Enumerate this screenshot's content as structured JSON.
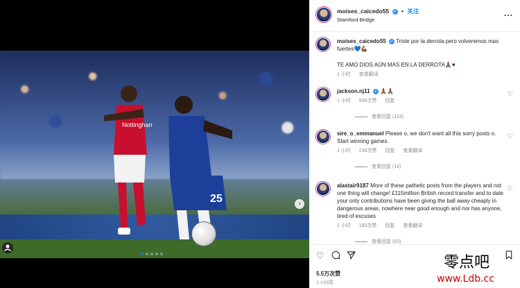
{
  "header": {
    "username": "moises_caicedo55",
    "follow_label": "关注",
    "location": "Stamford Bridge",
    "more": "..."
  },
  "caption": {
    "username": "moises_caicedo55",
    "text": "Triste por la derrota pero volveremos mas fuertes💙💪🏾",
    "text2": "TE AMO DIOS AÚN MAS EN LA DERROTA🙏🏾♥",
    "time": "1 小时",
    "see_translation": "查看翻译"
  },
  "comments": [
    {
      "username": "jackson.nj11",
      "text": "🙏🏾🙏🏾",
      "time": "1 小时",
      "likes": "588次赞",
      "reply": "回复",
      "view_replies": "查看回复 (124)"
    },
    {
      "username": "sire_o_emmanuel",
      "text": "Please o, we don't want all this sorry posts o. Start winning games.",
      "time": "1 小时",
      "likes": "238次赞",
      "reply": "回复",
      "translate": "查看翻译",
      "view_replies": "查看回复 (14)"
    },
    {
      "username": "alastair9187",
      "text": "More of these pathetic posts from the players and not one thing will change! £115million British record transfer and to date your only contributions have been giving the ball away cheaply in dangerous areas, nowhere near good enough and nor has anyone, tired of excuses",
      "time": "1 小时",
      "likes": "180次赞",
      "reply": "回复",
      "translate": "查看翻译",
      "view_replies": "查看回复 (63)"
    }
  ],
  "footer": {
    "likes": "5.5万次赞",
    "date": "1 小时前"
  },
  "photo": {
    "jersey_number": "25",
    "sponsor": "Nottingham"
  },
  "watermark": {
    "line1": "零点吧",
    "line2": "www.Ldb.cc"
  },
  "icons": [
    "heart-icon",
    "comment-icon",
    "share-icon",
    "bookmark-icon",
    "verified-icon",
    "more-icon",
    "chevron-right-icon",
    "user-tag-icon"
  ],
  "colors": {
    "link": "#0095f6",
    "verified": "#3897f0",
    "chelsea_blue": "#1d3f9a",
    "forest_red": "#c8102e"
  }
}
